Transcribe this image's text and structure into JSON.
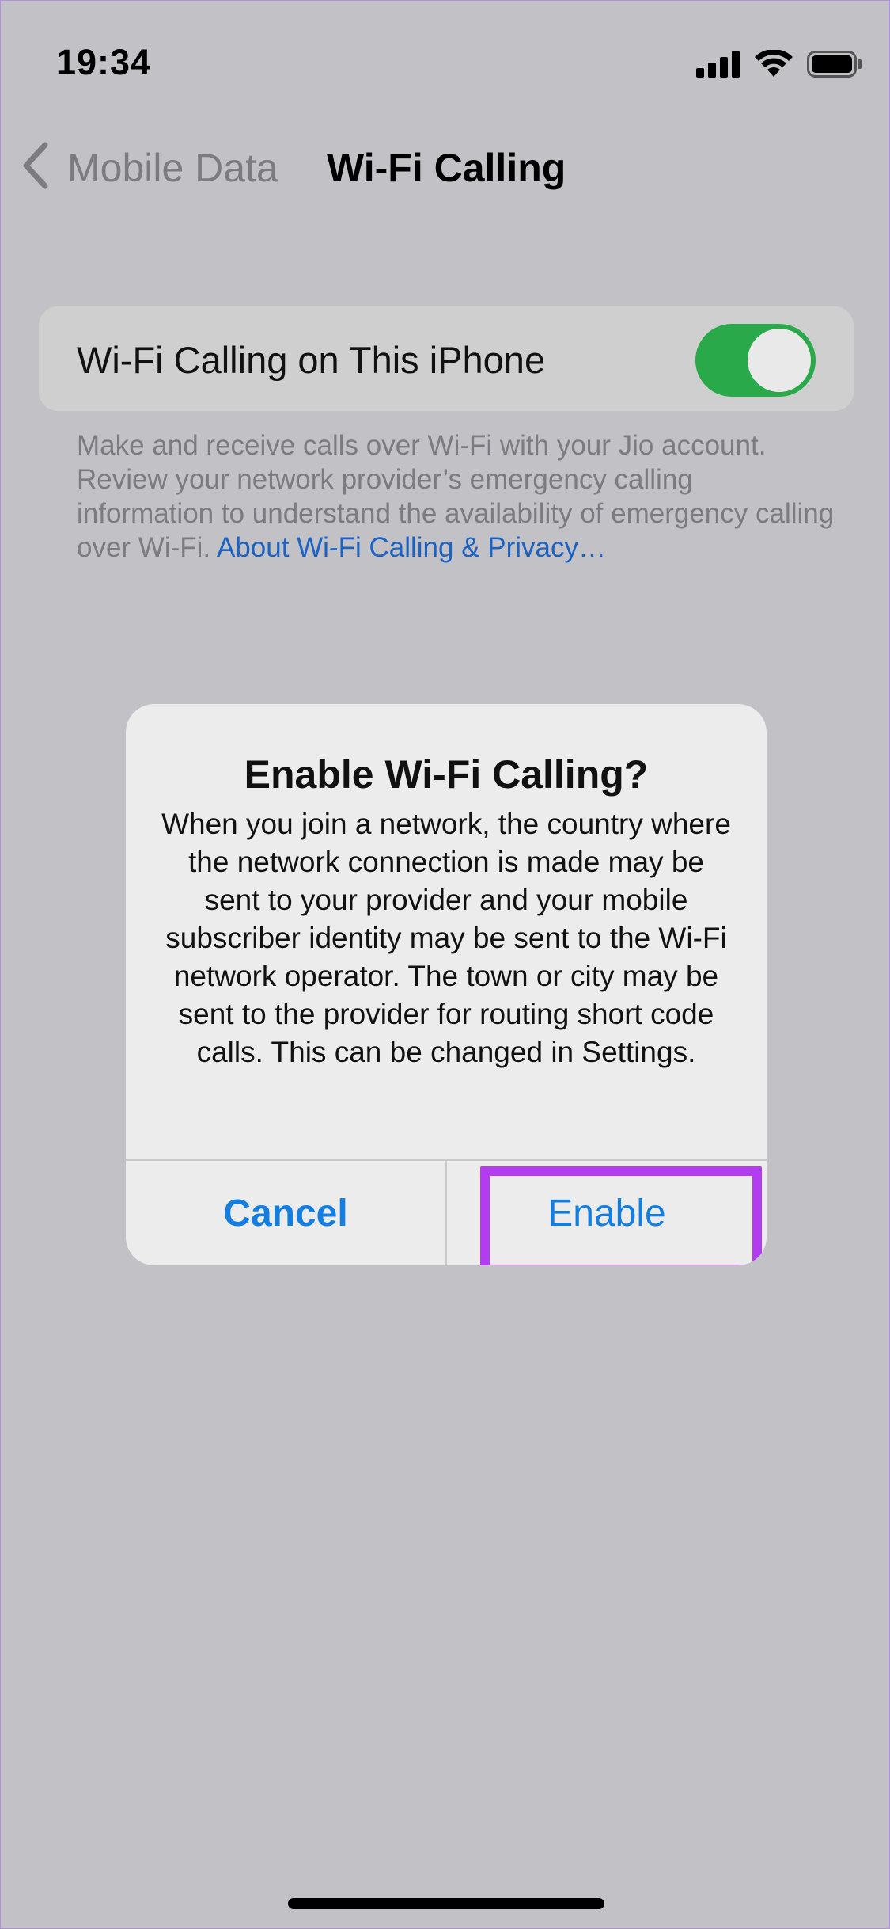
{
  "status_bar": {
    "time": "19:34",
    "icons": [
      "cellular-signal-icon",
      "wifi-icon",
      "battery-icon"
    ]
  },
  "nav": {
    "back_label": "Mobile Data",
    "title": "Wi-Fi Calling"
  },
  "settings": {
    "row_label": "Wi-Fi Calling on This iPhone",
    "toggle_on": true,
    "footer_text": "Make and receive calls over Wi-Fi with your Jio account. Review your network provider’s emergency calling information to understand the availability of emergency calling over Wi-Fi. ",
    "footer_link": "About Wi-Fi Calling & Privacy…"
  },
  "alert": {
    "title": "Enable Wi-Fi Calling?",
    "message": "When you join a network, the country where the network connection is made may be sent to your provider and your mobile subscriber identity may be sent to the Wi-Fi network operator. The town or city may be sent to the provider for routing short code calls. This can be changed in Settings.",
    "cancel_label": "Cancel",
    "enable_label": "Enable"
  },
  "colors": {
    "accent": "#147ee0",
    "toggle_on": "#2aa94a",
    "highlight": "#b43cf0",
    "backdrop": "#c2c1c6"
  }
}
